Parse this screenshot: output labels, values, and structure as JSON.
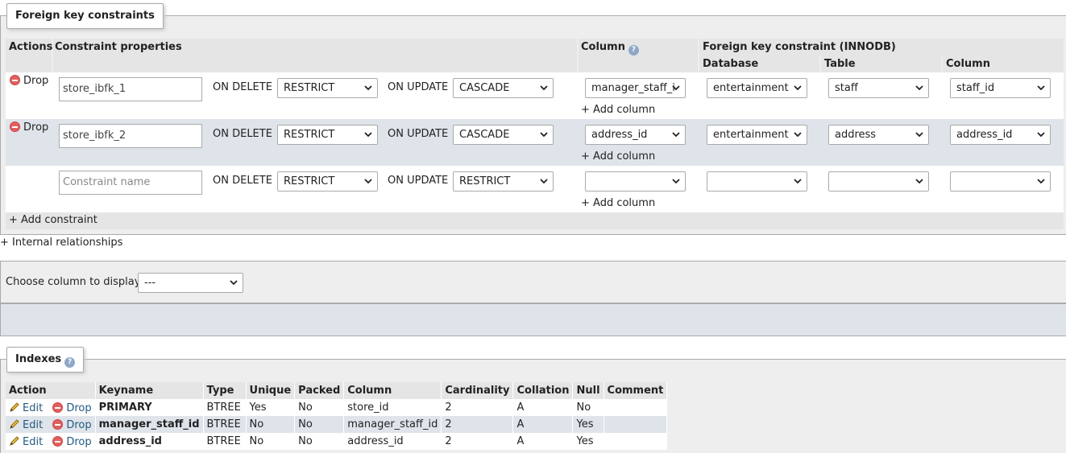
{
  "fk_section": {
    "legend": "Foreign key constraints",
    "headers": {
      "actions": "Actions",
      "constraint_properties": "Constraint properties",
      "column": "Column",
      "fk_constraint": "Foreign key constraint (INNODB)",
      "database": "Database",
      "table": "Table",
      "ref_column": "Column"
    },
    "rows": [
      {
        "drop": "Drop",
        "name": "store_ibfk_1",
        "on_delete_label": "ON DELETE",
        "on_delete": "RESTRICT",
        "on_update_label": "ON UPDATE",
        "on_update": "CASCADE",
        "column": "manager_staff_i",
        "add_column": "+ Add column",
        "database": "entertainment",
        "table": "staff",
        "ref_column": "staff_id"
      },
      {
        "drop": "Drop",
        "name": "store_ibfk_2",
        "on_delete_label": "ON DELETE",
        "on_delete": "RESTRICT",
        "on_update_label": "ON UPDATE",
        "on_update": "CASCADE",
        "column": "address_id",
        "add_column": "+ Add column",
        "database": "entertainment",
        "table": "address",
        "ref_column": "address_id"
      },
      {
        "placeholder": "Constraint name",
        "on_delete_label": "ON DELETE",
        "on_delete": "RESTRICT",
        "on_update_label": "ON UPDATE",
        "on_update": "RESTRICT",
        "column": "",
        "add_column": "+ Add column",
        "database": "",
        "table": "",
        "ref_column": ""
      }
    ],
    "add_constraint": "+ Add constraint"
  },
  "internal_relationships": "+ Internal relationships",
  "display_column": {
    "label": "Choose column to display:",
    "value": "---"
  },
  "indexes": {
    "legend": "Indexes",
    "headers": [
      "Action",
      "Keyname",
      "Type",
      "Unique",
      "Packed",
      "Column",
      "Cardinality",
      "Collation",
      "Null",
      "Comment"
    ],
    "edit_label": "Edit",
    "drop_label": "Drop",
    "rows": [
      {
        "keyname": "PRIMARY",
        "type": "BTREE",
        "unique": "Yes",
        "packed": "No",
        "column": "store_id",
        "cardinality": "2",
        "collation": "A",
        "null": "No",
        "comment": ""
      },
      {
        "keyname": "manager_staff_id",
        "type": "BTREE",
        "unique": "No",
        "packed": "No",
        "column": "manager_staff_id",
        "cardinality": "2",
        "collation": "A",
        "null": "Yes",
        "comment": ""
      },
      {
        "keyname": "address_id",
        "type": "BTREE",
        "unique": "No",
        "packed": "No",
        "column": "address_id",
        "cardinality": "2",
        "collation": "A",
        "null": "Yes",
        "comment": ""
      }
    ]
  },
  "colors": {
    "link": "#235a81",
    "header_bg": "#e5e5e5",
    "alt_row": "#dfe4ea",
    "drop_red": "#e06060"
  }
}
